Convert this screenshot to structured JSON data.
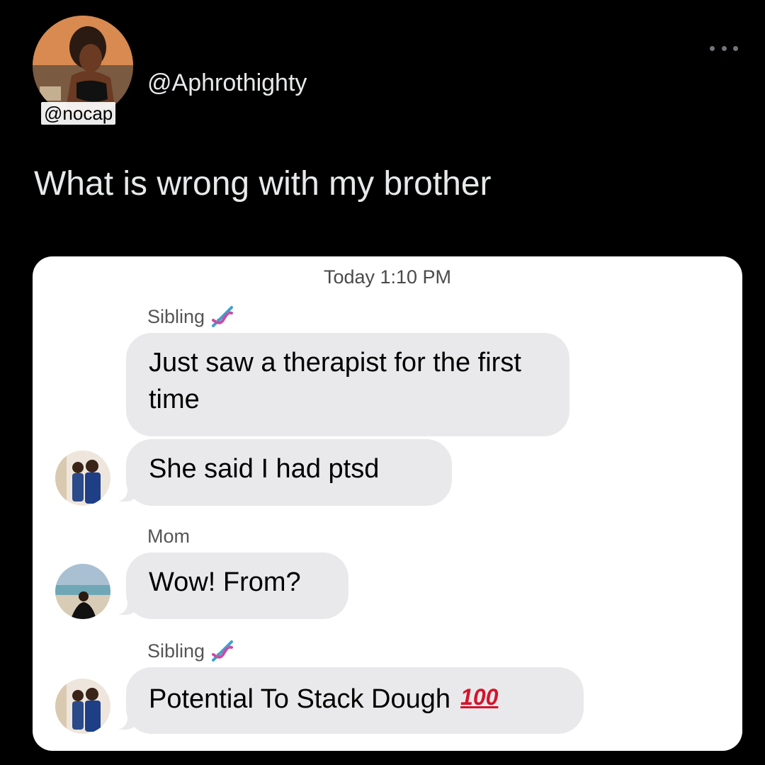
{
  "tweet": {
    "handle": "@Aphrothighty",
    "watermark": "@nocap",
    "text": "What is wrong with my brother"
  },
  "screenshot": {
    "timestamp": "Today 1:10 PM",
    "messages": [
      {
        "sender": "Sibling",
        "sender_icon": "dna-icon",
        "text": "Just saw a therapist for the first time"
      },
      {
        "text": "She said I had ptsd"
      },
      {
        "sender": "Mom",
        "text": "Wow! From?"
      },
      {
        "sender": "Sibling",
        "sender_icon": "dna-icon",
        "text": "Potential To Stack Dough",
        "trailing_icon": "hundred-points-icon"
      }
    ]
  },
  "colors": {
    "background": "#000000",
    "text_on_dark": "#e7e9ea",
    "bubble": "#e9e9eb",
    "card": "#ffffff"
  }
}
